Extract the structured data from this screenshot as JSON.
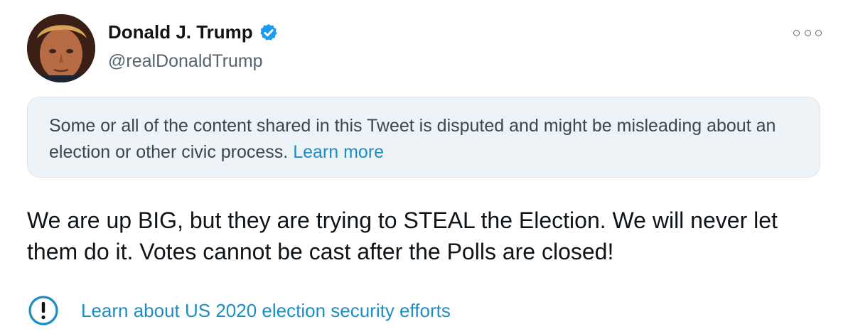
{
  "author": {
    "name": "Donald J. Trump",
    "handle": "@realDonaldTrump",
    "verified_icon": "verified-badge-icon",
    "avatar": "profile-photo"
  },
  "more_icon": "more-options-icon",
  "notice": {
    "text": "Some or all of the content shared in this Tweet is disputed and might be misleading about an election or other civic process. ",
    "link_label": "Learn more"
  },
  "tweet": {
    "text": "We are up BIG, but they are trying to STEAL the Election. We will never let them do it. Votes cannot be cast after the Polls are closed!"
  },
  "info": {
    "icon": "exclamation-circle-icon",
    "link_label": "Learn about US 2020 election security efforts"
  },
  "colors": {
    "accent": "#1d8ec5",
    "verified": "#1d9bf0",
    "notice_bg": "#eef3f7",
    "secondary_text": "#536471"
  }
}
